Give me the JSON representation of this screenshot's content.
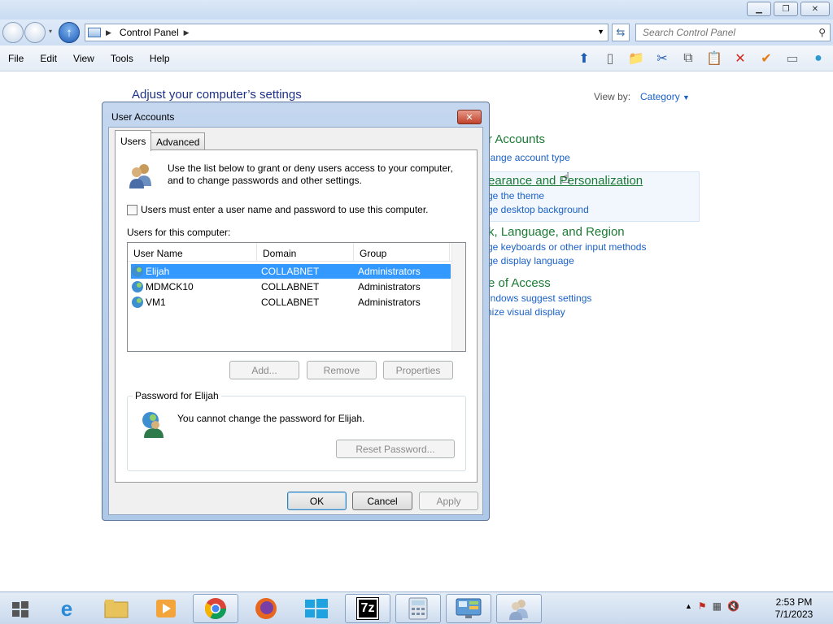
{
  "explorer": {
    "address_path": "Control Panel",
    "search_placeholder": "Search Control Panel",
    "menu": [
      "File",
      "Edit",
      "View",
      "Tools",
      "Help"
    ]
  },
  "control_panel": {
    "heading": "Adjust your computer’s settings",
    "view_by_label": "View by:",
    "view_by_value": "Category",
    "categories": [
      {
        "title": "r Accounts",
        "links": [
          "hange account type"
        ]
      },
      {
        "title": "earance and Personalization",
        "links": [
          "ge the theme",
          "ge desktop background"
        ]
      },
      {
        "title": "k, Language, and Region",
        "links": [
          "ge keyboards or other input methods",
          "ge display language"
        ]
      },
      {
        "title": "e of Access",
        "links": [
          "indows suggest settings",
          "nize visual display"
        ]
      }
    ]
  },
  "dialog": {
    "title": "User Accounts",
    "tabs": [
      "Users",
      "Advanced"
    ],
    "intro_text": "Use the list below to grant or deny users access to your computer, and to change passwords and other settings.",
    "require_login_label": "Users must enter a user name and password to use this computer.",
    "users_label": "Users for this computer:",
    "columns": [
      "User Name",
      "Domain",
      "Group"
    ],
    "users": [
      {
        "name": "Elijah",
        "domain": "COLLABNET",
        "group": "Administrators",
        "selected": true
      },
      {
        "name": "MDMCK10",
        "domain": "COLLABNET",
        "group": "Administrators",
        "selected": false
      },
      {
        "name": "VM1",
        "domain": "COLLABNET",
        "group": "Administrators",
        "selected": false
      }
    ],
    "add_label": "Add...",
    "remove_label": "Remove",
    "properties_label": "Properties",
    "password_group_label": "Password for Elijah",
    "password_text": "You cannot change the password for Elijah.",
    "reset_password_label": "Reset Password...",
    "ok_label": "OK",
    "cancel_label": "Cancel",
    "apply_label": "Apply"
  },
  "taskbar": {
    "time": "2:53 PM",
    "date": "7/1/2023"
  },
  "colors": {
    "selection": "#3399ff",
    "category_green": "#1b7a34",
    "link_blue": "#1b61c7"
  }
}
